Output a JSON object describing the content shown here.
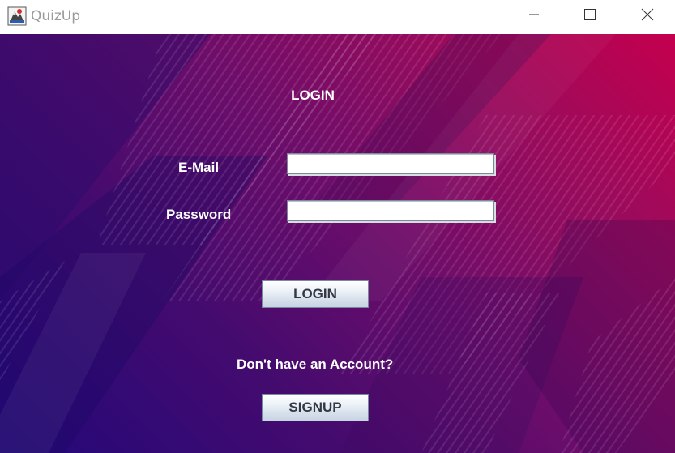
{
  "window": {
    "title": "QuizUp",
    "icons": {
      "app": "quizup-app-icon",
      "minimize": "minimize-icon",
      "maximize": "maximize-icon",
      "close": "close-icon"
    }
  },
  "form": {
    "heading": "LOGIN",
    "email_label": "E-Mail",
    "email_value": "",
    "password_label": "Password",
    "password_value": "",
    "login_button": "LOGIN",
    "signup_prompt": "Don't have an Account?",
    "signup_button": "SIGNUP"
  },
  "colors": {
    "background_start": "#22087a",
    "background_end": "#c4004e",
    "text": "#ffffff",
    "button_text": "#333844"
  }
}
